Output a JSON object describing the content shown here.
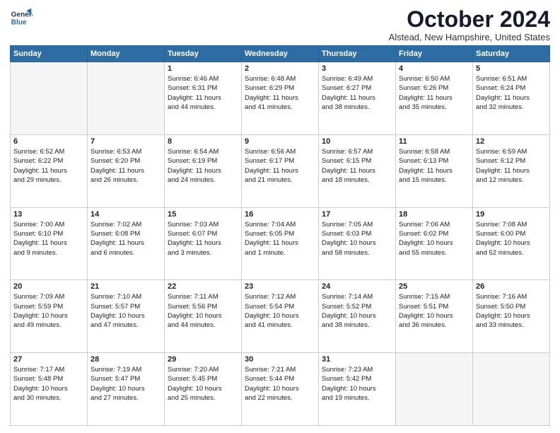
{
  "logo": {
    "line1": "General",
    "line2": "Blue"
  },
  "title": "October 2024",
  "location": "Alstead, New Hampshire, United States",
  "days_header": [
    "Sunday",
    "Monday",
    "Tuesday",
    "Wednesday",
    "Thursday",
    "Friday",
    "Saturday"
  ],
  "weeks": [
    [
      {
        "day": "",
        "empty": true
      },
      {
        "day": "",
        "empty": true
      },
      {
        "day": "1",
        "lines": [
          "Sunrise: 6:46 AM",
          "Sunset: 6:31 PM",
          "Daylight: 11 hours",
          "and 44 minutes."
        ]
      },
      {
        "day": "2",
        "lines": [
          "Sunrise: 6:48 AM",
          "Sunset: 6:29 PM",
          "Daylight: 11 hours",
          "and 41 minutes."
        ]
      },
      {
        "day": "3",
        "lines": [
          "Sunrise: 6:49 AM",
          "Sunset: 6:27 PM",
          "Daylight: 11 hours",
          "and 38 minutes."
        ]
      },
      {
        "day": "4",
        "lines": [
          "Sunrise: 6:50 AM",
          "Sunset: 6:26 PM",
          "Daylight: 11 hours",
          "and 35 minutes."
        ]
      },
      {
        "day": "5",
        "lines": [
          "Sunrise: 6:51 AM",
          "Sunset: 6:24 PM",
          "Daylight: 11 hours",
          "and 32 minutes."
        ]
      }
    ],
    [
      {
        "day": "6",
        "lines": [
          "Sunrise: 6:52 AM",
          "Sunset: 6:22 PM",
          "Daylight: 11 hours",
          "and 29 minutes."
        ]
      },
      {
        "day": "7",
        "lines": [
          "Sunrise: 6:53 AM",
          "Sunset: 6:20 PM",
          "Daylight: 11 hours",
          "and 26 minutes."
        ]
      },
      {
        "day": "8",
        "lines": [
          "Sunrise: 6:54 AM",
          "Sunset: 6:19 PM",
          "Daylight: 11 hours",
          "and 24 minutes."
        ]
      },
      {
        "day": "9",
        "lines": [
          "Sunrise: 6:56 AM",
          "Sunset: 6:17 PM",
          "Daylight: 11 hours",
          "and 21 minutes."
        ]
      },
      {
        "day": "10",
        "lines": [
          "Sunrise: 6:57 AM",
          "Sunset: 6:15 PM",
          "Daylight: 11 hours",
          "and 18 minutes."
        ]
      },
      {
        "day": "11",
        "lines": [
          "Sunrise: 6:58 AM",
          "Sunset: 6:13 PM",
          "Daylight: 11 hours",
          "and 15 minutes."
        ]
      },
      {
        "day": "12",
        "lines": [
          "Sunrise: 6:59 AM",
          "Sunset: 6:12 PM",
          "Daylight: 11 hours",
          "and 12 minutes."
        ]
      }
    ],
    [
      {
        "day": "13",
        "lines": [
          "Sunrise: 7:00 AM",
          "Sunset: 6:10 PM",
          "Daylight: 11 hours",
          "and 9 minutes."
        ]
      },
      {
        "day": "14",
        "lines": [
          "Sunrise: 7:02 AM",
          "Sunset: 6:08 PM",
          "Daylight: 11 hours",
          "and 6 minutes."
        ]
      },
      {
        "day": "15",
        "lines": [
          "Sunrise: 7:03 AM",
          "Sunset: 6:07 PM",
          "Daylight: 11 hours",
          "and 3 minutes."
        ]
      },
      {
        "day": "16",
        "lines": [
          "Sunrise: 7:04 AM",
          "Sunset: 6:05 PM",
          "Daylight: 11 hours",
          "and 1 minute."
        ]
      },
      {
        "day": "17",
        "lines": [
          "Sunrise: 7:05 AM",
          "Sunset: 6:03 PM",
          "Daylight: 10 hours",
          "and 58 minutes."
        ]
      },
      {
        "day": "18",
        "lines": [
          "Sunrise: 7:06 AM",
          "Sunset: 6:02 PM",
          "Daylight: 10 hours",
          "and 55 minutes."
        ]
      },
      {
        "day": "19",
        "lines": [
          "Sunrise: 7:08 AM",
          "Sunset: 6:00 PM",
          "Daylight: 10 hours",
          "and 52 minutes."
        ]
      }
    ],
    [
      {
        "day": "20",
        "lines": [
          "Sunrise: 7:09 AM",
          "Sunset: 5:59 PM",
          "Daylight: 10 hours",
          "and 49 minutes."
        ]
      },
      {
        "day": "21",
        "lines": [
          "Sunrise: 7:10 AM",
          "Sunset: 5:57 PM",
          "Daylight: 10 hours",
          "and 47 minutes."
        ]
      },
      {
        "day": "22",
        "lines": [
          "Sunrise: 7:11 AM",
          "Sunset: 5:56 PM",
          "Daylight: 10 hours",
          "and 44 minutes."
        ]
      },
      {
        "day": "23",
        "lines": [
          "Sunrise: 7:12 AM",
          "Sunset: 5:54 PM",
          "Daylight: 10 hours",
          "and 41 minutes."
        ]
      },
      {
        "day": "24",
        "lines": [
          "Sunrise: 7:14 AM",
          "Sunset: 5:52 PM",
          "Daylight: 10 hours",
          "and 38 minutes."
        ]
      },
      {
        "day": "25",
        "lines": [
          "Sunrise: 7:15 AM",
          "Sunset: 5:51 PM",
          "Daylight: 10 hours",
          "and 36 minutes."
        ]
      },
      {
        "day": "26",
        "lines": [
          "Sunrise: 7:16 AM",
          "Sunset: 5:50 PM",
          "Daylight: 10 hours",
          "and 33 minutes."
        ]
      }
    ],
    [
      {
        "day": "27",
        "lines": [
          "Sunrise: 7:17 AM",
          "Sunset: 5:48 PM",
          "Daylight: 10 hours",
          "and 30 minutes."
        ]
      },
      {
        "day": "28",
        "lines": [
          "Sunrise: 7:19 AM",
          "Sunset: 5:47 PM",
          "Daylight: 10 hours",
          "and 27 minutes."
        ]
      },
      {
        "day": "29",
        "lines": [
          "Sunrise: 7:20 AM",
          "Sunset: 5:45 PM",
          "Daylight: 10 hours",
          "and 25 minutes."
        ]
      },
      {
        "day": "30",
        "lines": [
          "Sunrise: 7:21 AM",
          "Sunset: 5:44 PM",
          "Daylight: 10 hours",
          "and 22 minutes."
        ]
      },
      {
        "day": "31",
        "lines": [
          "Sunrise: 7:23 AM",
          "Sunset: 5:42 PM",
          "Daylight: 10 hours",
          "and 19 minutes."
        ]
      },
      {
        "day": "",
        "empty": true
      },
      {
        "day": "",
        "empty": true
      }
    ]
  ]
}
